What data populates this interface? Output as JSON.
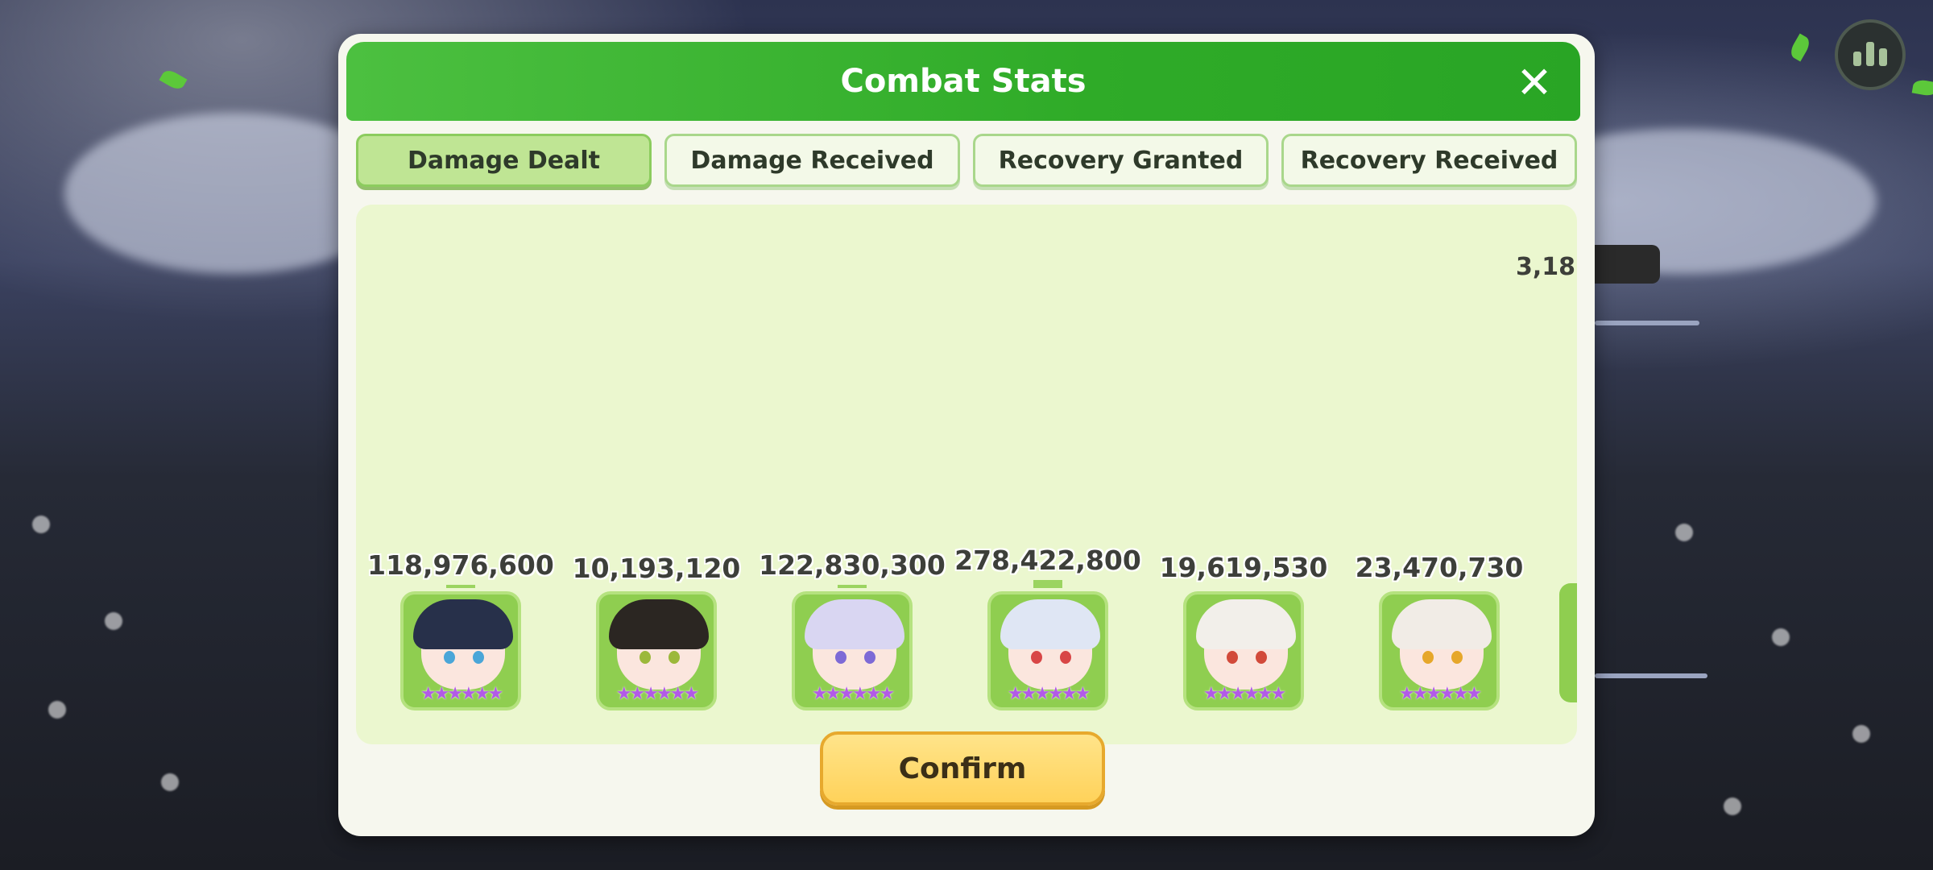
{
  "dialog": {
    "title": "Combat Stats",
    "close_icon": "close-icon",
    "tabs": [
      {
        "label": "Damage Dealt",
        "active": true
      },
      {
        "label": "Damage Received",
        "active": false
      },
      {
        "label": "Recovery Granted",
        "active": false
      },
      {
        "label": "Recovery Received",
        "active": false
      }
    ],
    "confirm_label": "Confirm"
  },
  "characters": [
    {
      "value_text": "118,976,600",
      "value": 118976600,
      "stars": 6,
      "hair": "#27304a",
      "eyes": "#4aa6d8"
    },
    {
      "value_text": "10,193,120",
      "value": 10193120,
      "stars": 6,
      "hair": "#2b2622",
      "eyes": "#9bb83a"
    },
    {
      "value_text": "122,830,300",
      "value": 122830300,
      "stars": 6,
      "hair": "#d9d6f2",
      "eyes": "#7d6ad6"
    },
    {
      "value_text": "278,422,800",
      "value": 278422800,
      "stars": 6,
      "hair": "#dfe6f4",
      "eyes": "#d84646"
    },
    {
      "value_text": "19,619,530",
      "value": 19619530,
      "stars": 6,
      "hair": "#f2efea",
      "eyes": "#d24a3a"
    },
    {
      "value_text": "23,470,730",
      "value": 23470730,
      "stars": 6,
      "hair": "#f1ece6",
      "eyes": "#e6a72a"
    }
  ],
  "cut_off_value": "3,18",
  "colors": {
    "title_green": "#2fab28",
    "panel_bg": "#ebf7cf",
    "bar_green": "#9bd460",
    "confirm_yellow": "#ffd25a"
  }
}
